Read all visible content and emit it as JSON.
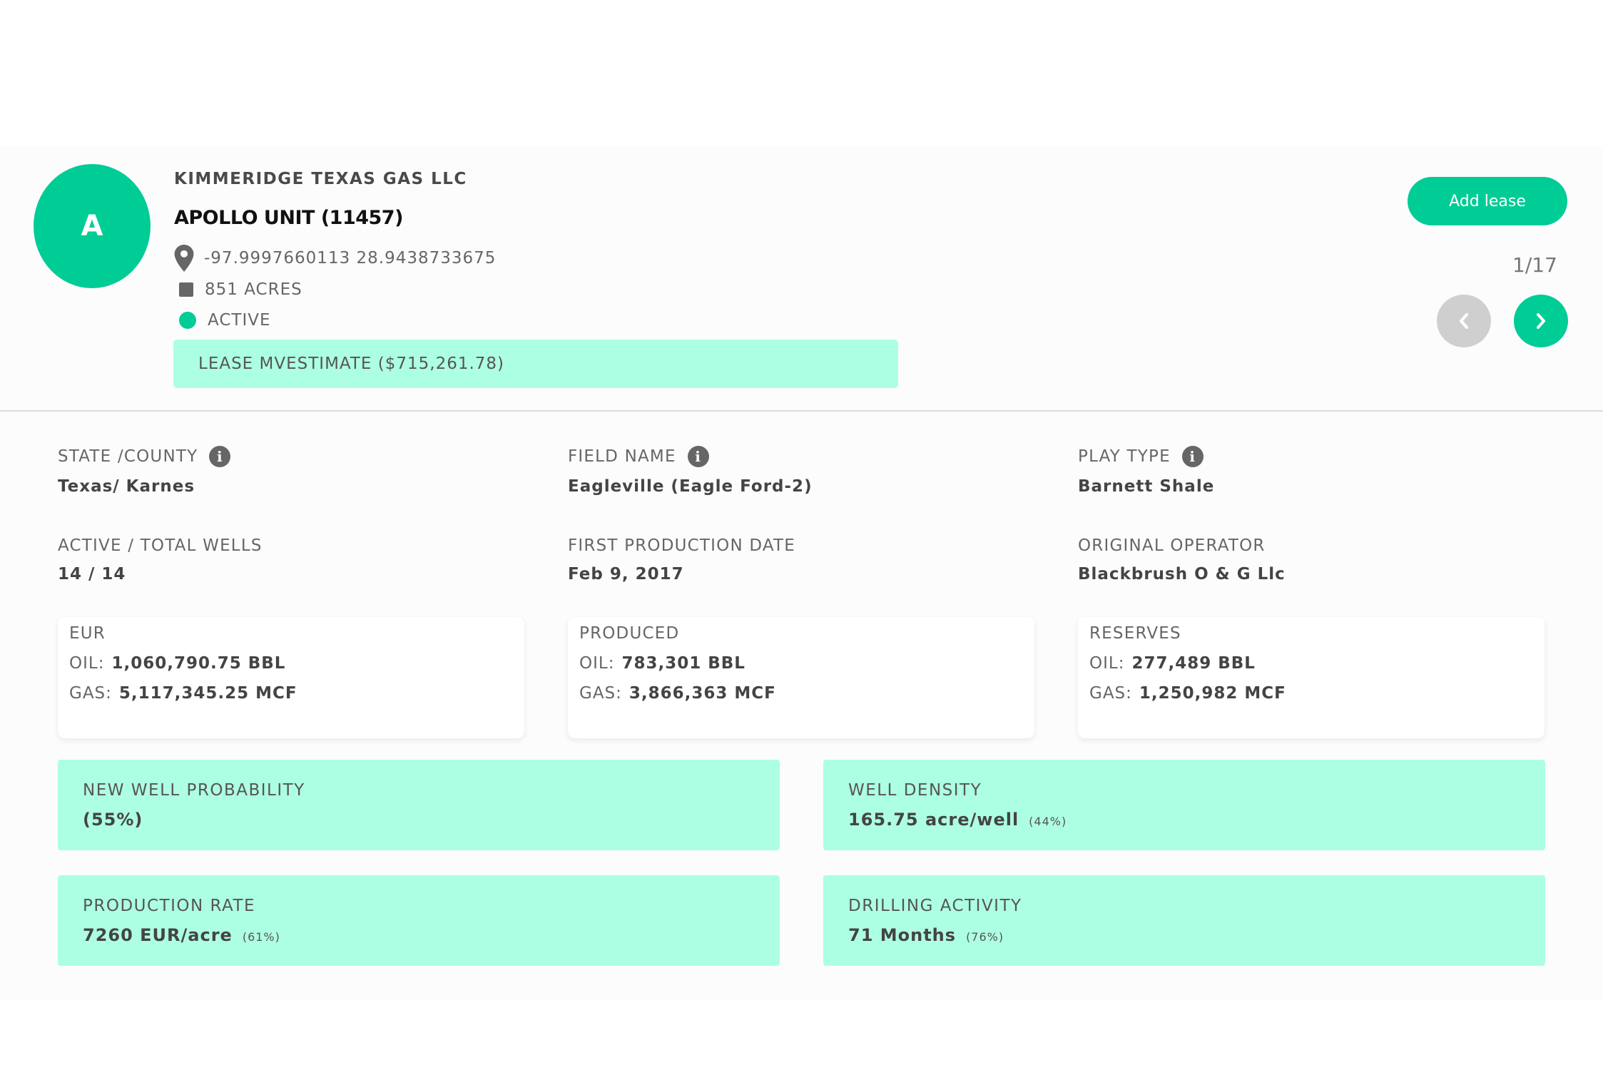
{
  "header": {
    "avatar_letter": "A",
    "company": "KIMMERIDGE TEXAS GAS LLC",
    "lease_name": "APOLLO UNIT (11457)",
    "coordinates": "-97.9997660113 28.9438733675",
    "acres": "851 ACRES",
    "status": "ACTIVE",
    "estimate": "LEASE MVESTIMATE ($715,261.78)",
    "add_lease_label": "Add lease",
    "pager": "1/17",
    "prev_icon": "chevron-left-icon",
    "next_icon": "chevron-right-icon"
  },
  "info": {
    "state_county": {
      "label": "STATE /COUNTY",
      "value": "Texas/ Karnes"
    },
    "field_name": {
      "label": "FIELD NAME",
      "value": "Eagleville (Eagle Ford-2)"
    },
    "play_type": {
      "label": "PLAY TYPE",
      "value": "Barnett Shale"
    },
    "wells": {
      "label": "ACTIVE / TOTAL WELLS",
      "value": "14 / 14"
    },
    "first_production": {
      "label": "FIRST PRODUCTION DATE",
      "value": "Feb 9, 2017"
    },
    "original_operator": {
      "label": "ORIGINAL OPERATOR",
      "value": "Blackbrush O & G Llc"
    }
  },
  "cards": {
    "eur": {
      "title": "EUR",
      "oil_label": "OIL:",
      "oil_value": "1,060,790.75 BBL",
      "gas_label": "GAS:",
      "gas_value": "5,117,345.25 MCF"
    },
    "produced": {
      "title": "PRODUCED",
      "oil_label": "OIL:",
      "oil_value": "783,301 BBL",
      "gas_label": "GAS:",
      "gas_value": "3,866,363 MCF"
    },
    "reserves": {
      "title": "RESERVES",
      "oil_label": "OIL:",
      "oil_value": "277,489 BBL",
      "gas_label": "GAS:",
      "gas_value": "1,250,982 MCF"
    }
  },
  "metrics": {
    "new_well": {
      "title": "NEW WELL PROBABILITY",
      "value": "(55%)",
      "pct": ""
    },
    "well_density": {
      "title": "WELL DENSITY",
      "value": "165.75 acre/well",
      "pct": "(44%)"
    },
    "production_rate": {
      "title": "PRODUCTION RATE",
      "value": "7260 EUR/acre",
      "pct": "(61%)"
    },
    "drilling_activity": {
      "title": "DRILLING ACTIVITY",
      "value": "71 Months",
      "pct": "(76%)"
    }
  },
  "colors": {
    "accent": "#00cc96",
    "highlight": "#adffe3",
    "disabled": "#cfcfcf"
  }
}
